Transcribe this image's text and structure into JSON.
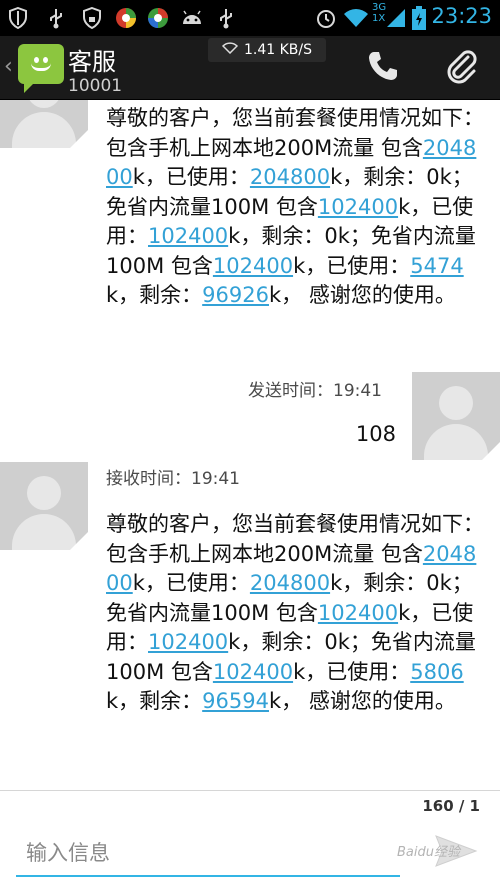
{
  "status_bar": {
    "time": "23:23",
    "network_labels": [
      "3G",
      "1X"
    ],
    "icons": [
      "shield-icon",
      "usb-icon",
      "lock-shield-icon",
      "browser-red-icon",
      "browser-green-icon",
      "android-icon",
      "usb2-icon",
      "alarm-icon",
      "wifi-icon",
      "signal-icon",
      "battery-icon"
    ]
  },
  "header": {
    "contact_name": "客服",
    "contact_number": "10001",
    "network_speed": "1.41 KB/S"
  },
  "messages": [
    {
      "direction": "received",
      "parts": [
        {
          "t": "尊敬的客户，您当前套餐使用情况如下：包含手机上网本地200M流量 包含"
        },
        {
          "t": "204800",
          "link": true
        },
        {
          "t": "k，已使用："
        },
        {
          "t": "204800",
          "link": true
        },
        {
          "t": "k，剩余：0k；免省内流量100M 包含"
        },
        {
          "t": "102400",
          "link": true
        },
        {
          "t": "k，已使用："
        },
        {
          "t": "102400",
          "link": true
        },
        {
          "t": "k，剩余：0k；免省内流量100M 包含"
        },
        {
          "t": "102400",
          "link": true
        },
        {
          "t": "k，已使用："
        },
        {
          "t": "5474",
          "link": true
        },
        {
          "t": "k，剩余："
        },
        {
          "t": "96926",
          "link": true
        },
        {
          "t": "k， 感谢您的使用。"
        }
      ]
    },
    {
      "direction": "sent",
      "time_label": "发送时间：19:41",
      "body": "108"
    },
    {
      "direction": "received",
      "time_label": "接收时间：19:41",
      "parts": [
        {
          "t": "尊敬的客户，您当前套餐使用情况如下：包含手机上网本地200M流量 包含"
        },
        {
          "t": "204800",
          "link": true
        },
        {
          "t": "k，已使用："
        },
        {
          "t": "204800",
          "link": true
        },
        {
          "t": "k，剩余：0k；免省内流量100M 包含"
        },
        {
          "t": "102400",
          "link": true
        },
        {
          "t": "k，已使用："
        },
        {
          "t": "102400",
          "link": true
        },
        {
          "t": "k，剩余：0k；免省内流量100M 包含"
        },
        {
          "t": "102400",
          "link": true
        },
        {
          "t": "k，已使用："
        },
        {
          "t": "5806",
          "link": true
        },
        {
          "t": "k，剩余："
        },
        {
          "t": "96594",
          "link": true
        },
        {
          "t": "k， 感谢您的使用。"
        }
      ]
    }
  ],
  "compose": {
    "char_counter": "160 / 1",
    "placeholder": "输入信息",
    "watermark": "Baidu经验"
  },
  "colors": {
    "accent": "#33b5e5",
    "link": "#33a1d6",
    "app_icon": "#8cc63f"
  }
}
